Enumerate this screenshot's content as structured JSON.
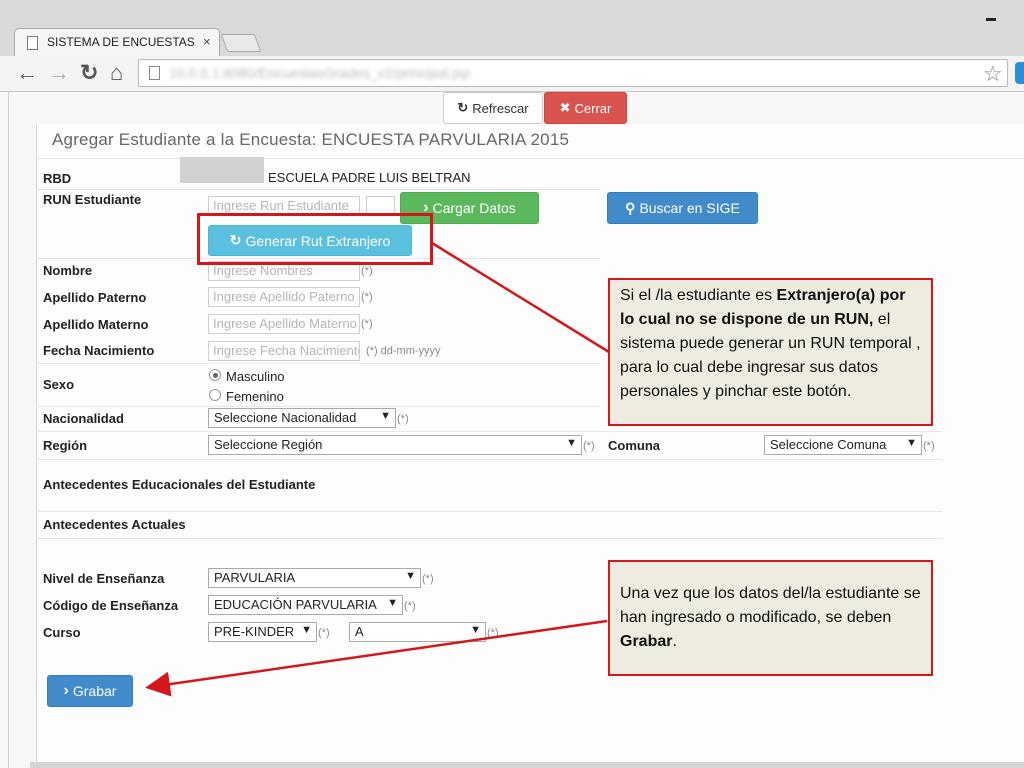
{
  "browser": {
    "tab_title": "SISTEMA DE ENCUESTAS",
    "tab_close": "×",
    "back": "←",
    "forward": "→",
    "reload": "↻",
    "home": "⌂",
    "url": "10.0.0.1:8080/EncuestasGrades_v2/principal.jsp",
    "bookmark_star": "☆"
  },
  "page_buttons": {
    "refrescar": "Refrescar",
    "cerrar": "Cerrar",
    "refresh_icon": "↻",
    "close_icon": "✖"
  },
  "form": {
    "title": "Agregar Estudiante a la Encuesta: ENCUESTA PARVULARIA 2015",
    "rbd_label": "RBD",
    "rbd_value": "ESCUELA PADRE LUIS BELTRAN",
    "run_label": "RUN Estudiante",
    "run_placeholder": "Ingrese Run Estudiante",
    "cargar_datos": "Cargar Datos",
    "buscar_sige": "Buscar en SIGE",
    "generar_rut": "Generar Rut Extranjero",
    "nombre_label": "Nombre",
    "nombre_placeholder": "Ingrese Nombres",
    "apellido_paterno_label": "Apellido Paterno",
    "apellido_paterno_placeholder": "Ingrese Apellido Paterno",
    "apellido_materno_label": "Apellido Materno",
    "apellido_materno_placeholder": "Ingrese Apellido Materno",
    "fecha_label": "Fecha Nacimiento",
    "fecha_placeholder": "Ingrese Fecha Nacimiento",
    "fecha_hint": "(*) dd-mm-yyyy",
    "required": "(*)",
    "sexo_label": "Sexo",
    "sexo_options": [
      "Masculino",
      "Femenino"
    ],
    "nacionalidad_label": "Nacionalidad",
    "nacionalidad_value": "Seleccione Nacionalidad",
    "region_label": "Región",
    "region_value": "Seleccione Región",
    "comuna_label": "Comuna",
    "comuna_value": "Seleccione Comuna",
    "antecedentes_educacionales": "Antecedentes Educacionales del Estudiante",
    "antecedentes_actuales": "Antecedentes Actuales",
    "nivel_label": "Nivel de Enseñanza",
    "nivel_value": "PARVULARIA",
    "codigo_label": "Código de Enseñanza",
    "codigo_value": "EDUCACIÓN PARVULARIA",
    "curso_label": "Curso",
    "curso_value": "PRE-KINDER",
    "letra_value": "A",
    "grabar": "Grabar",
    "arrow_icon": "›",
    "dropdown_arrow": "▼"
  },
  "callouts": {
    "top": {
      "part1": "Si el /la estudiante es ",
      "bold1": "Extranjero(a) por lo cual no se dispone de un RUN,",
      "part2": " el sistema puede generar un RUN temporal , para lo cual debe ingresar sus  datos personales y pinchar este botón."
    },
    "bottom": {
      "part1": "Una vez que los datos del/la estudiante se han ingresado o modificado, se deben ",
      "bold1": "Grabar",
      "part2": "."
    }
  },
  "colors": {
    "annotation_red": "#d3171b",
    "callout_bg": "#eeece1",
    "success_green": "#5cb85c",
    "primary_blue": "#428bca",
    "info_cyan": "#5bc0de",
    "danger_red": "#d9534f"
  }
}
